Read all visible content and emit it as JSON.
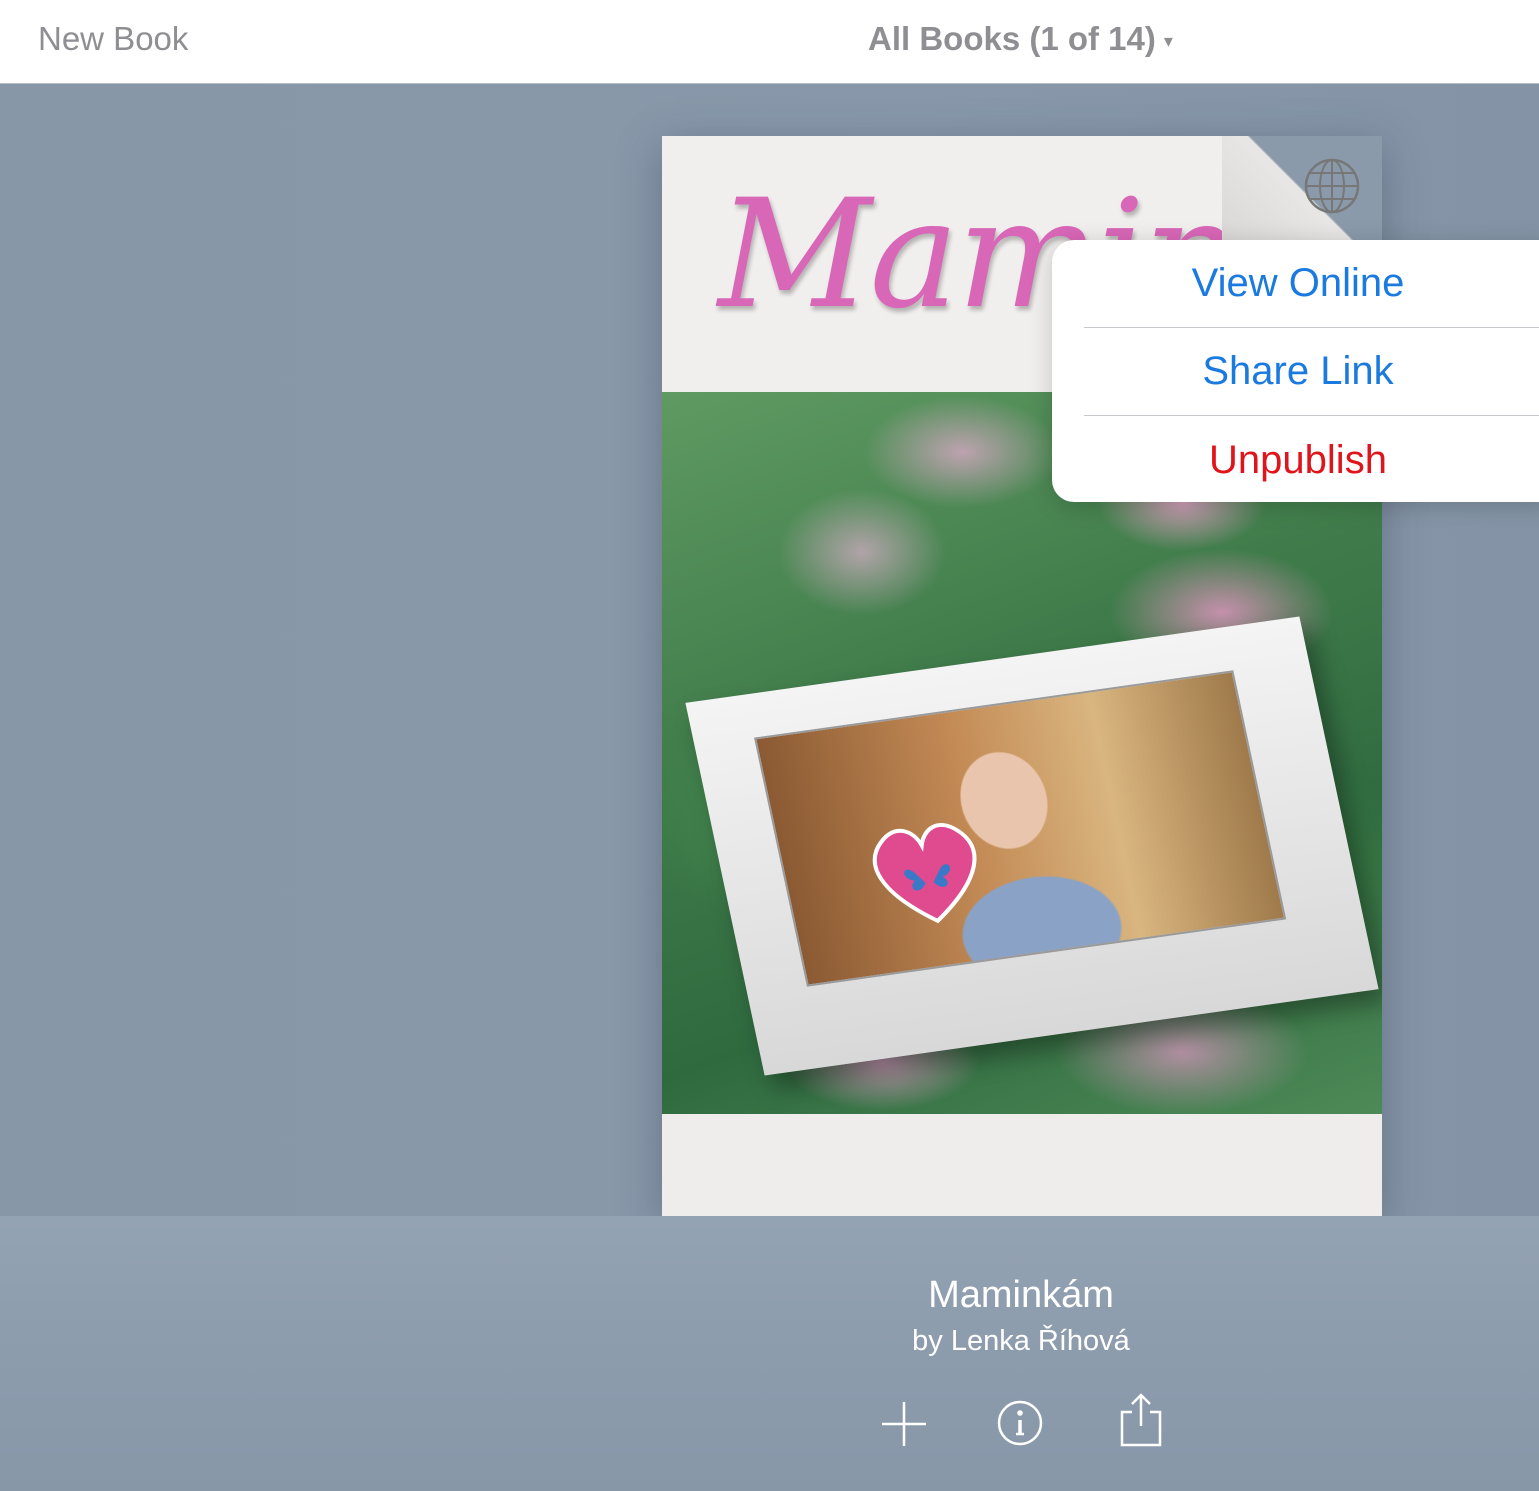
{
  "topbar": {
    "new_book_label": "New Book",
    "all_books_label": "All Books (1 of 14)",
    "caret": "▾"
  },
  "cover": {
    "title_script": "Maminkám",
    "globe_icon": "globe-icon"
  },
  "popover": {
    "items": [
      {
        "label": "View Online",
        "color": "#1a7ae0"
      },
      {
        "label": "Share Link",
        "color": "#1a7ae0"
      },
      {
        "label": "Unpublish",
        "color": "#e0141b"
      }
    ]
  },
  "book": {
    "title": "Maminkám",
    "author": "by Lenka Říhová"
  },
  "actions": {
    "icons": [
      "plus-icon",
      "info-icon",
      "share-icon"
    ]
  },
  "colors": {
    "accent": "#1a7ae0",
    "destructive": "#e0141b",
    "background": "#8a9aab"
  }
}
